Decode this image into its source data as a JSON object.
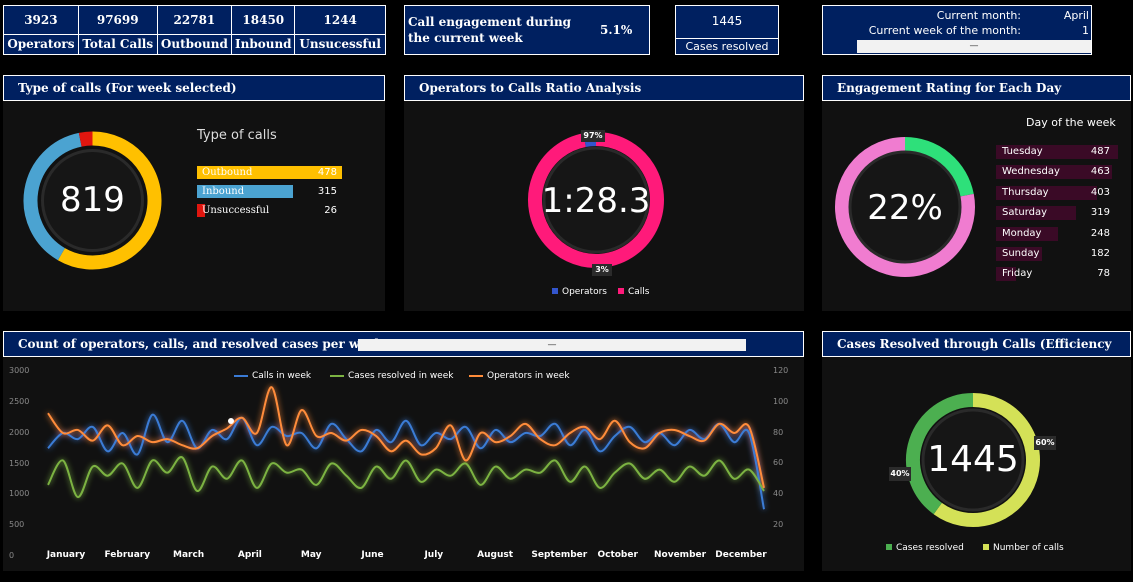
{
  "kpis": [
    {
      "value": "3923",
      "label": "Operators"
    },
    {
      "value": "97699",
      "label": "Total Calls"
    },
    {
      "value": "22781",
      "label": "Outbound"
    },
    {
      "value": "18450",
      "label": "Inbound"
    },
    {
      "value": "1244",
      "label": "Unsucessful"
    }
  ],
  "engagement": {
    "label": "Call engagement during the current week",
    "value": "5.1%"
  },
  "cases_resolved": {
    "value": "1445",
    "label": "Cases resolved"
  },
  "current": {
    "month_label": "Current month:",
    "month_value": "April",
    "week_label": "Current week of the month:",
    "week_value": "1",
    "selector": "—"
  },
  "type_of_calls": {
    "title": "Type of calls (For week selected)",
    "total": "819",
    "subtitle": "Type of calls",
    "items": [
      {
        "label": "Outbound",
        "value": "478",
        "color": "#FFC000",
        "num": 478
      },
      {
        "label": "Inbound",
        "value": "315",
        "color": "#4BA3D1",
        "num": 315
      },
      {
        "label": "Unsuccessful",
        "value": "26",
        "color": "#E0160F",
        "num": 26
      }
    ]
  },
  "ratio": {
    "title": "Operators to Calls Ratio Analysis",
    "center": "1:28.3",
    "calls_pct": "97%",
    "operators_pct": "3%",
    "calls_frac": 0.97,
    "legend": [
      {
        "label": "Operators",
        "color": "#3355CC"
      },
      {
        "label": "Calls",
        "color": "#FF1A7A"
      }
    ]
  },
  "engagement_rating": {
    "title": "Engagement Rating for Each Day",
    "center": "22%",
    "frac": 0.22,
    "subtitle": "Day of the week",
    "days": [
      {
        "label": "Tuesday",
        "value": "487",
        "num": 487
      },
      {
        "label": "Wednesday",
        "value": "463",
        "num": 463
      },
      {
        "label": "Thursday",
        "value": "403",
        "num": 403
      },
      {
        "label": "Saturday",
        "value": "319",
        "num": 319
      },
      {
        "label": "Monday",
        "value": "248",
        "num": 248
      },
      {
        "label": "Sunday",
        "value": "182",
        "num": 182
      },
      {
        "label": "Friday",
        "value": "78",
        "num": 78
      }
    ]
  },
  "weekly": {
    "title": "Count of operators, calls, and resolved cases per week",
    "selector": "—"
  },
  "efficiency": {
    "title": "Cases Resolved through Calls (Efficiency",
    "center": "1445",
    "resolved_pct": "40%",
    "calls_pct": "60%",
    "resolved_frac": 0.4,
    "legend": [
      {
        "label": "Cases resolved",
        "color": "#4CAF50"
      },
      {
        "label": "Number of calls",
        "color": "#D4E157"
      }
    ]
  },
  "chart_data": {
    "type": "line",
    "x": [
      "January",
      "February",
      "March",
      "April",
      "May",
      "June",
      "July",
      "August",
      "September",
      "October",
      "November",
      "December"
    ],
    "y_left_ticks": [
      "0",
      "500",
      "1000",
      "1500",
      "2000",
      "2500",
      "3000"
    ],
    "y_right_ticks": [
      "20",
      "40",
      "60",
      "80",
      "100",
      "120"
    ],
    "ylim_left": [
      0,
      3000
    ],
    "ylim_right": [
      0,
      120
    ],
    "series": [
      {
        "name": "Calls in week",
        "color": "#3A7BD5",
        "axis": "left",
        "values": [
          1750,
          2000,
          1900,
          2100,
          1700,
          2000,
          1650,
          2300,
          1850,
          2200,
          1750,
          2050,
          1900,
          2250,
          1800,
          2100,
          1950,
          2000,
          1750,
          2150,
          1900,
          1700,
          2050,
          1850,
          2200,
          1800,
          2000,
          1900,
          2100,
          1750,
          2050,
          1850,
          2000,
          1950,
          2150,
          1800,
          2050,
          1700,
          1950,
          2100,
          1850,
          2000,
          1800,
          2050,
          1900,
          2150,
          1850,
          2000,
          750
        ]
      },
      {
        "name": "Cases resolved in week",
        "color": "#7CB342",
        "axis": "left",
        "values": [
          1150,
          1550,
          950,
          1450,
          1300,
          1500,
          1100,
          1550,
          1350,
          1600,
          1050,
          1450,
          1250,
          1550,
          1100,
          1500,
          1350,
          1400,
          1150,
          1500,
          1300,
          1100,
          1450,
          1250,
          1550,
          1200,
          1400,
          1300,
          1500,
          1150,
          1450,
          1250,
          1400,
          1350,
          1550,
          1200,
          1450,
          1100,
          1350,
          1500,
          1250,
          1400,
          1200,
          1450,
          1300,
          1550,
          1250,
          1400,
          1050
        ]
      },
      {
        "name": "Operators in week",
        "color": "#FF8C3A",
        "axis": "right",
        "values": [
          93,
          80,
          82,
          75,
          85,
          72,
          78,
          74,
          76,
          72,
          70,
          78,
          83,
          90,
          80,
          110,
          72,
          95,
          78,
          80,
          75,
          82,
          78,
          68,
          75,
          66,
          70,
          85,
          62,
          80,
          74,
          78,
          86,
          76,
          72,
          80,
          84,
          76,
          88,
          74,
          70,
          80,
          82,
          78,
          75,
          86,
          80,
          84,
          44
        ]
      }
    ]
  }
}
